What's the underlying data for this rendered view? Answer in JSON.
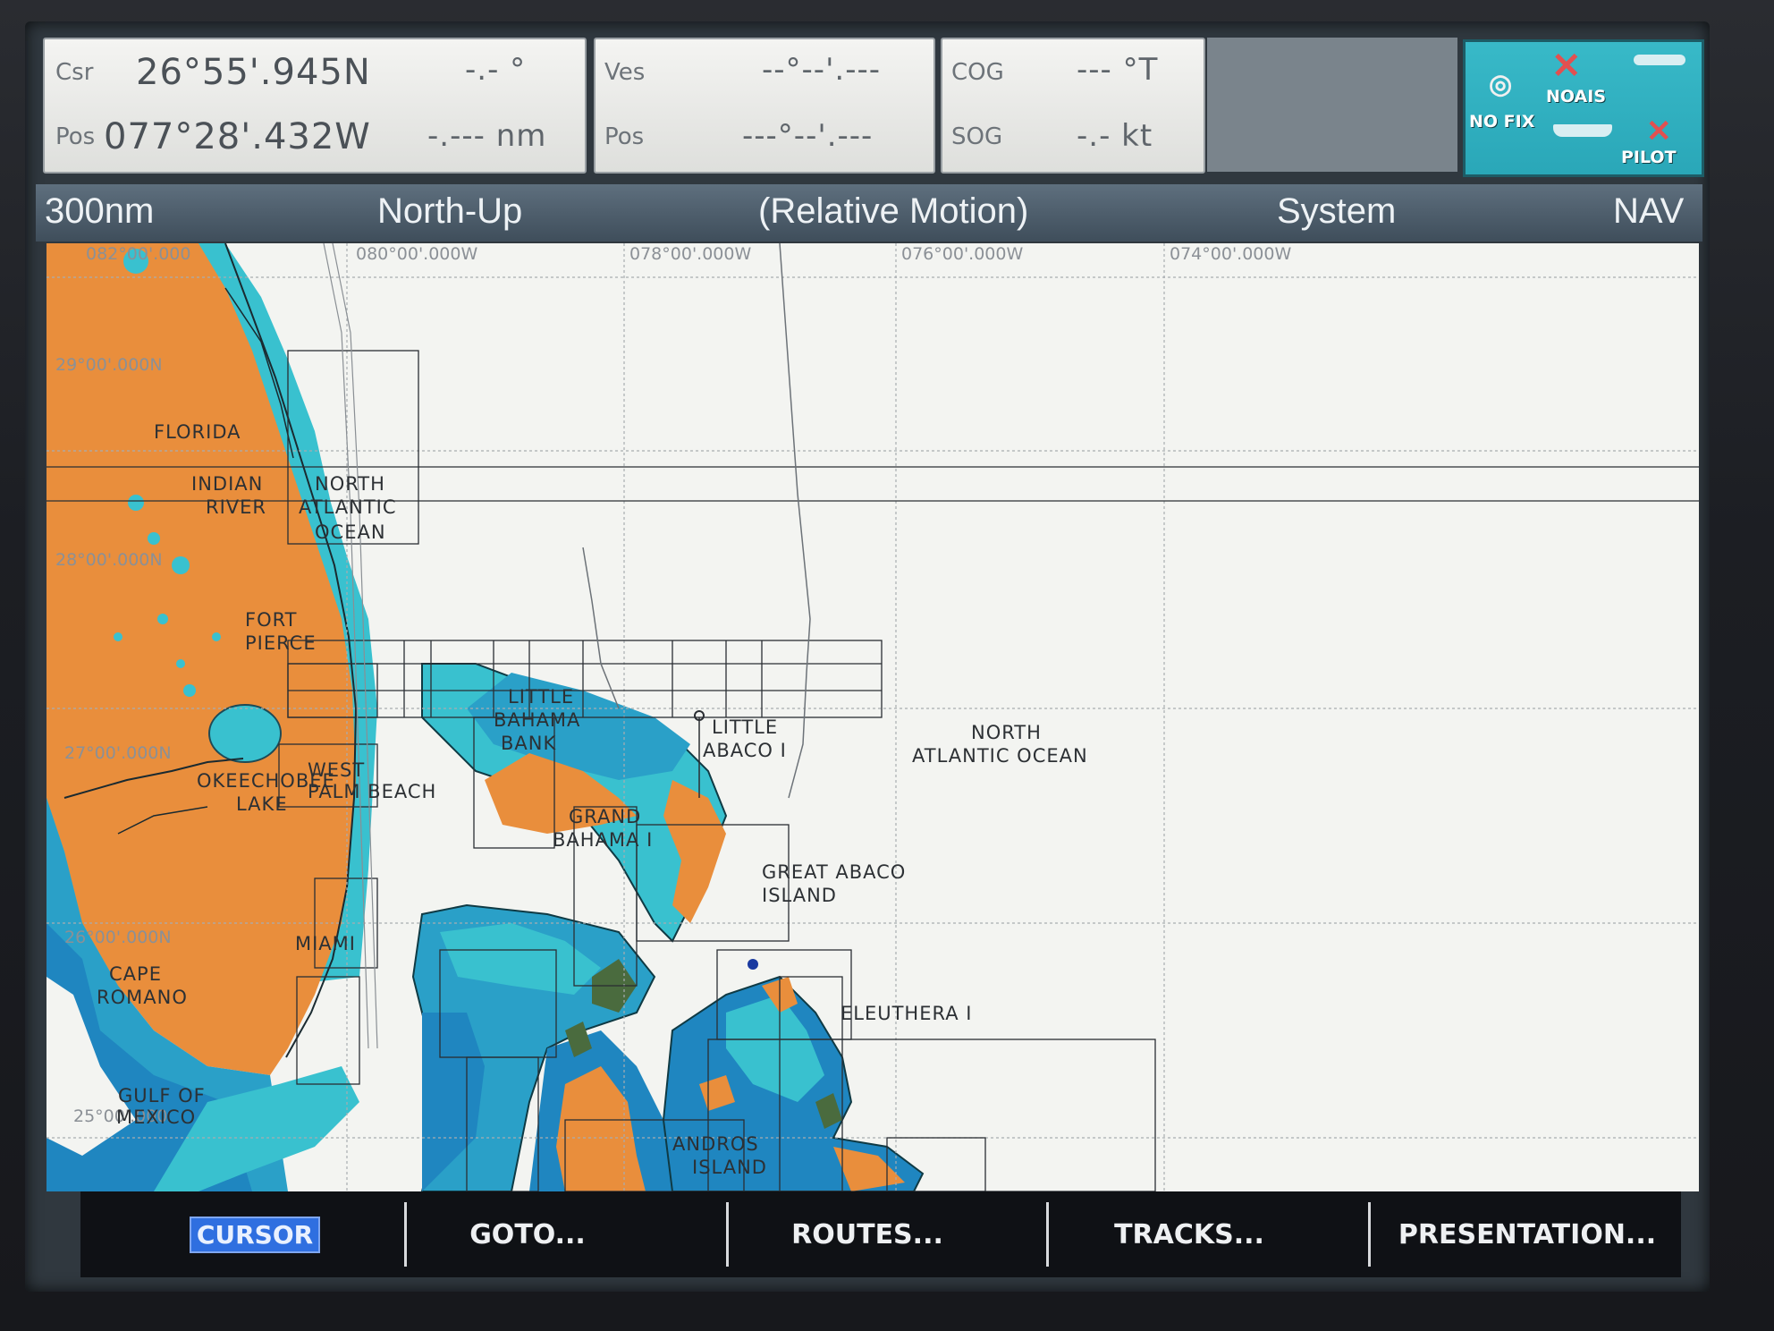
{
  "databar": {
    "csr_label": "Csr",
    "csr_lat": "26°55'.945N",
    "csr_bearing": "-.- °",
    "pos_label": "Pos",
    "pos_lon": "077°28'.432W",
    "pos_range": "-.--- nm",
    "ves_label": "Ves",
    "ves_value": "--°--'.---",
    "ves_pos_label": "Pos",
    "ves_pos_value": "---°--'.---",
    "cog_label": "COG",
    "cog_value": "--- °T",
    "sog_label": "SOG",
    "sog_value": "-.- kt"
  },
  "status": {
    "nofix": "NO FIX",
    "noais": "NOAIS",
    "pilot": "PILOT"
  },
  "titlebar": {
    "range": "300nm",
    "orientation": "North-Up",
    "motion": "(Relative Motion)",
    "mode": "System",
    "page": "NAV"
  },
  "chart": {
    "lon_labels": [
      "082°00'.000",
      "080°00'.000W",
      "078°00'.000W",
      "076°00'.000W",
      "074°00'.000W"
    ],
    "lat_labels": [
      "29°00'.000N",
      "28°00'.000N",
      "27°00'.000N",
      "26°00'.000N",
      "25°00'.000"
    ],
    "places": {
      "florida": "FLORIDA",
      "indian_river_1": "INDIAN",
      "indian_river_2": "RIVER",
      "nao_small_1": "NORTH",
      "nao_small_2": "ATLANTIC",
      "nao_small_3": "OCEAN",
      "fort_pierce_1": "FORT",
      "fort_pierce_2": "PIERCE",
      "okeechobee_1": "OKEECHOBEE",
      "okeechobee_2": "LAKE",
      "west_palm_1": "WEST",
      "west_palm_2": "PALM BEACH",
      "miami": "MIAMI",
      "cape_romano_1": "CAPE",
      "cape_romano_2": "ROMANO",
      "gulf_1": "GULF OF",
      "gulf_2": "MEXICO",
      "little_bahama_1": "LITTLE",
      "little_bahama_2": "BAHAMA",
      "little_bahama_3": "BANK",
      "little_abaco_1": "LITTLE",
      "little_abaco_2": "ABACO I",
      "grand_bahama_1": "GRAND",
      "grand_bahama_2": "BAHAMA I",
      "great_abaco_1": "GREAT ABACO",
      "great_abaco_2": "ISLAND",
      "nao_big_1": "NORTH",
      "nao_big_2": "ATLANTIC OCEAN",
      "eleuthera": "ELEUTHERA I",
      "andros_1": "ANDROS",
      "andros_2": "ISLAND"
    },
    "colors": {
      "land": "#e98e3c",
      "shallow": "#39c1cf",
      "medium": "#2aa0c8",
      "deep": "#1f86c0",
      "sea": "#f3f4f1"
    }
  },
  "softkeys": {
    "cursor": "CURSOR",
    "goto": "GOTO...",
    "routes": "ROUTES...",
    "tracks": "TRACKS...",
    "presentation": "PRESENTATION..."
  }
}
